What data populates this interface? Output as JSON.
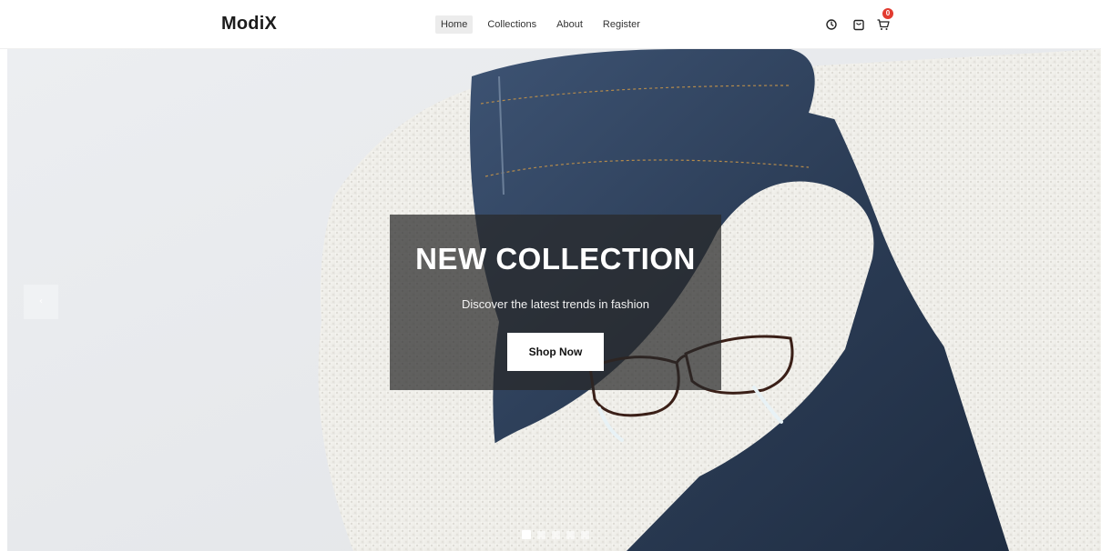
{
  "brand": {
    "name": "ModiX"
  },
  "nav": {
    "items": [
      {
        "label": "Home",
        "active": true
      },
      {
        "label": "Collections",
        "active": false
      },
      {
        "label": "About",
        "active": false
      },
      {
        "label": "Register",
        "active": false
      }
    ]
  },
  "header_icons": {
    "history": "clock-icon",
    "bag": "shopping-bag-icon",
    "cart": "cart-icon",
    "cart_count": "0"
  },
  "hero": {
    "title": "NEW COLLECTION",
    "subtitle": "Discover the latest trends in fashion",
    "cta_label": "Shop Now",
    "prev_arrow": "‹",
    "next_arrow": "›",
    "slide_count": 5,
    "active_slide": 0
  },
  "colors": {
    "badge": "#e23b30",
    "overlay": "rgba(40,40,40,0.72)",
    "denim": "#2d3f58",
    "knit": "#f4f3ef"
  }
}
